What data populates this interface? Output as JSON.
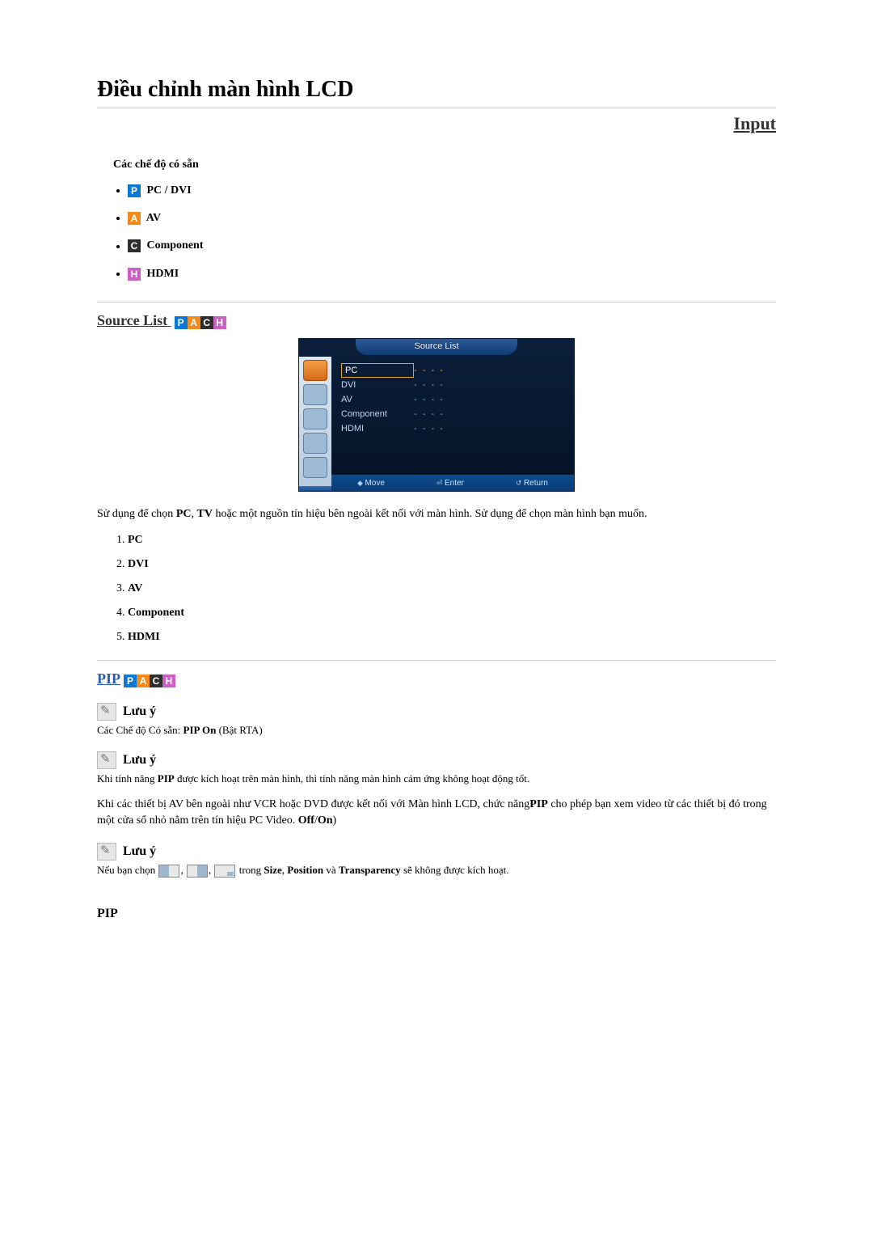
{
  "title": "Điều chỉnh màn hình LCD",
  "rightTitle": "Input",
  "modesHeading": "Các chế độ có sẵn",
  "modes": {
    "p": "PC / DVI",
    "a": "AV",
    "c": "Component",
    "h": "HDMI"
  },
  "sourceList": {
    "title": "Source List",
    "osd": {
      "tab": "Source List",
      "rows": {
        "pc": "PC",
        "dvi": "DVI",
        "av": "AV",
        "component": "Component",
        "hdmi": "HDMI"
      },
      "dots": "- - - -",
      "footer": {
        "move": "Move",
        "enter": "Enter",
        "return": "Return"
      }
    },
    "desc_pre": "Sử dụng để chọn ",
    "desc_pc": "PC",
    "desc_mid1": ", ",
    "desc_tv": "TV",
    "desc_rest": " hoặc một nguồn tín hiệu bên ngoài kết nối với màn hình. Sử dụng để chọn màn hình bạn muốn.",
    "list": {
      "pc": "PC",
      "dvi": "DVI",
      "av": "AV",
      "component": "Component",
      "hdmi": "HDMI"
    }
  },
  "pip": {
    "title": "PIP",
    "note1Title": "Lưu ý",
    "note1_pre": "Các Chế độ Có sẵn: ",
    "note1_bold": "PIP On",
    "note1_post": " (Bật RTA)",
    "note2Title": "Lưu ý",
    "note2_pre": "Khi tính năng ",
    "note2_b1": "PIP",
    "note2_post": " được kích hoạt trên màn hình, thì tính năng màn hình cảm ứng không hoạt động tốt.",
    "para_pre": "Khi các thiết bị AV bên ngoài như VCR hoặc DVD được kết nối với Màn hình LCD, chức năng",
    "para_b1": "PIP",
    "para_mid": " cho phép bạn xem video từ các thiết bị đó trong một cửa sổ nhỏ nằm trên tín hiệu PC Video. ",
    "para_b2": "Off",
    "para_slash": "/",
    "para_b3": "On",
    "para_close": ")",
    "note3Title": "Lưu ý",
    "note3_pre": "Nếu bạn chọn ",
    "note3_mid": " trong ",
    "note3_size": "Size",
    "note3_c1": ", ",
    "note3_pos": "Position",
    "note3_and": " và ",
    "note3_trans": "Transparency",
    "note3_post": " sẽ không được kích hoạt.",
    "sub": "PIP"
  }
}
